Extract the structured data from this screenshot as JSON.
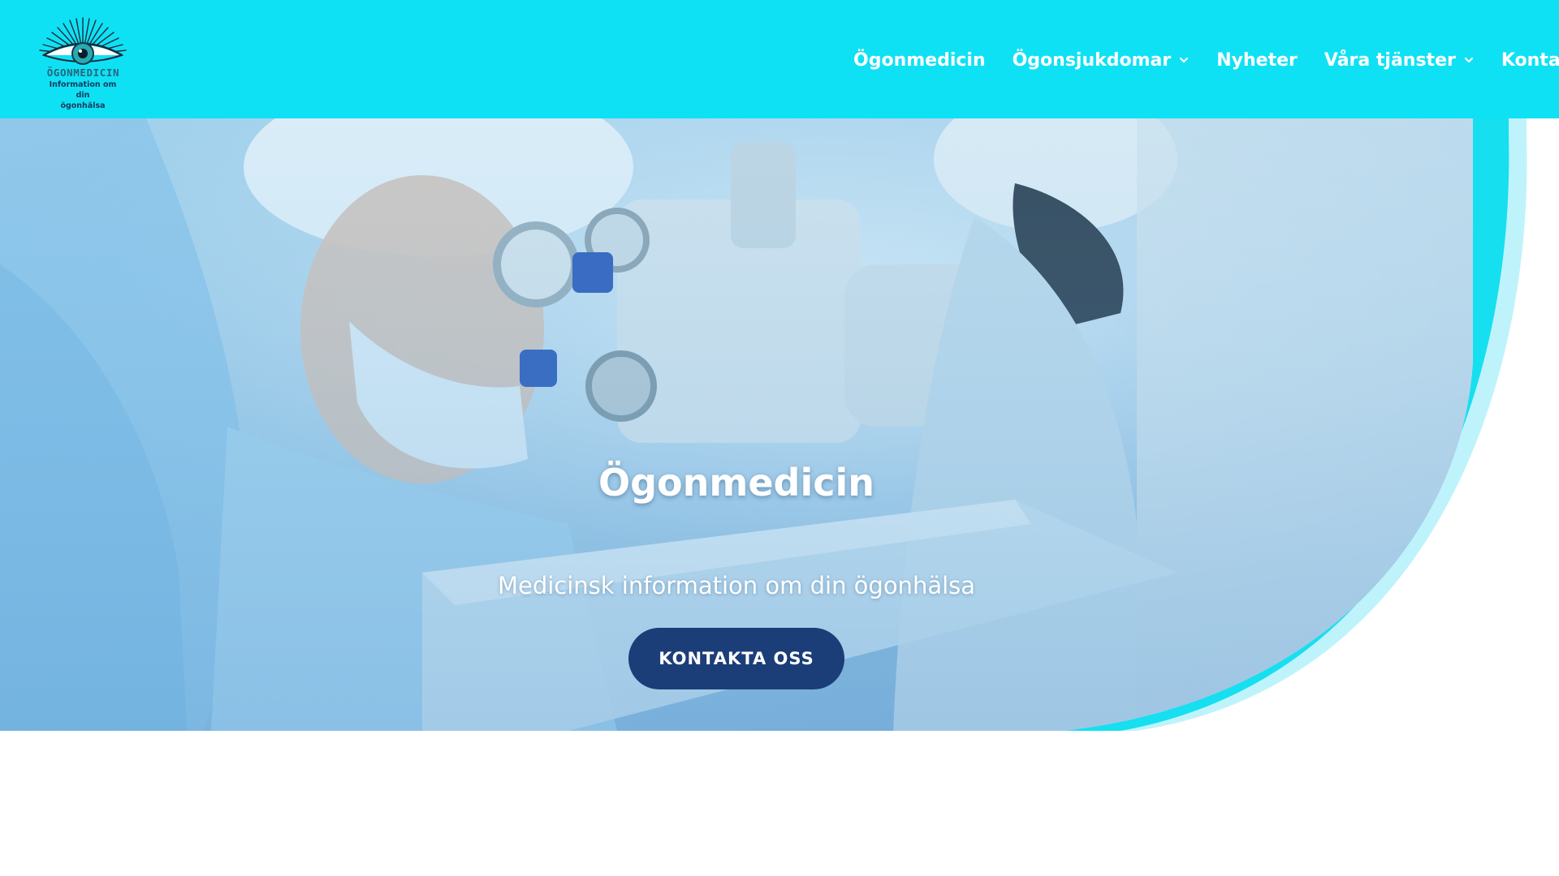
{
  "header": {
    "logo": {
      "title": "ÖGONMEDICIN",
      "subtitle_line1": "Information om din",
      "subtitle_line2": "ögonhälsa"
    },
    "nav": [
      {
        "label": "Ögonmedicin",
        "has_dropdown": false
      },
      {
        "label": "Ögonsjukdomar",
        "has_dropdown": true
      },
      {
        "label": "Nyheter",
        "has_dropdown": false
      },
      {
        "label": "Våra tjänster",
        "has_dropdown": true
      },
      {
        "label": "Kontakt",
        "has_dropdown": false
      }
    ]
  },
  "hero": {
    "title": "Ögonmedicin",
    "subtitle": "Medicinsk information om din ögonhälsa",
    "cta_label": "KONTAKTA OSS"
  },
  "colors": {
    "header_bg": "#0fe1f5",
    "accent_cyan": "#16dff0",
    "button_bg": "#1b3e78",
    "text_light": "#ffffff"
  },
  "icons": {
    "logo": "eye-icon",
    "dropdown": "chevron-down-icon"
  }
}
